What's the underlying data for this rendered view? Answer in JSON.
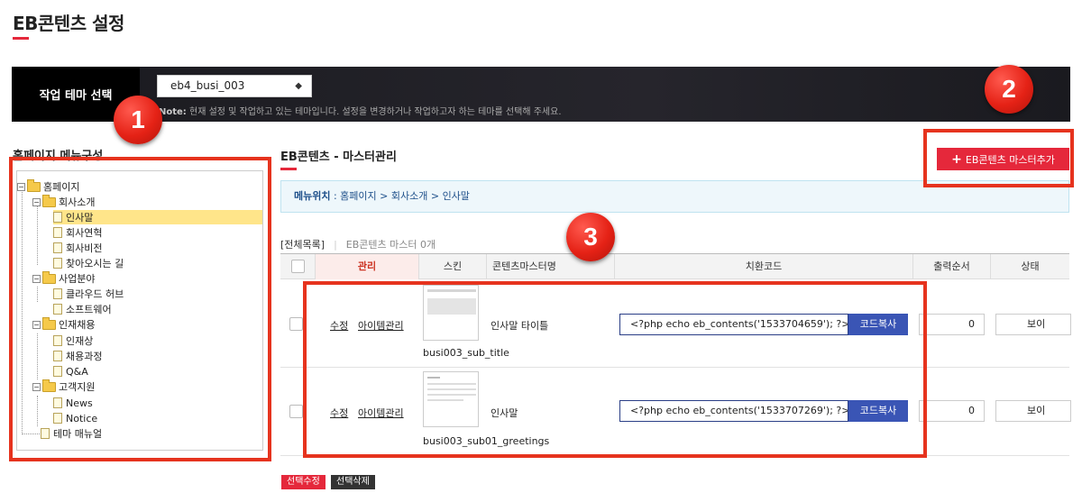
{
  "page": {
    "title": "EB콘텐츠 설정"
  },
  "theme": {
    "label": "작업 테마 선택",
    "selected": "eb4_busi_003",
    "select_arrows": "◆",
    "note_prefix": "Note:",
    "note_text": " 현재 설정 및 작업하고 있는 테마입니다. 설정을 변경하거나 작업하고자 하는 테마를 선택해 주세요."
  },
  "markers": [
    "1",
    "2",
    "3"
  ],
  "menu": {
    "title": "홈페이지 메뉴구성",
    "tree": [
      {
        "label": "홈페이지",
        "type": "folder",
        "toggle": "−"
      },
      {
        "label": "회사소개",
        "type": "folder",
        "toggle": "−"
      },
      {
        "label": "인사말",
        "type": "doc",
        "selected": true
      },
      {
        "label": "회사연혁",
        "type": "doc"
      },
      {
        "label": "회사비전",
        "type": "doc"
      },
      {
        "label": "찾아오시는 길",
        "type": "doc"
      },
      {
        "label": "사업분야",
        "type": "folder",
        "toggle": "−"
      },
      {
        "label": "클라우드 허브",
        "type": "doc"
      },
      {
        "label": "소프트웨어",
        "type": "doc"
      },
      {
        "label": "인재채용",
        "type": "folder",
        "toggle": "−"
      },
      {
        "label": "인재상",
        "type": "doc"
      },
      {
        "label": "채용과정",
        "type": "doc"
      },
      {
        "label": "Q&A",
        "type": "doc"
      },
      {
        "label": "고객지원",
        "type": "folder",
        "toggle": "−"
      },
      {
        "label": "News",
        "type": "doc"
      },
      {
        "label": "Notice",
        "type": "doc"
      },
      {
        "label": "테마 매뉴얼",
        "type": "doc"
      }
    ]
  },
  "content": {
    "title": "EB콘텐츠 - 마스터관리",
    "add_button": "EB콘텐츠 마스터추가",
    "add_plus": "+",
    "location_label": "메뉴위치",
    "location_path": " : 홈페이지 > 회사소개 > 인사말",
    "tab_all": "[전체목록]",
    "tab_sep": "|",
    "tab_count": "EB콘텐츠 마스터 0개",
    "columns": [
      "관리",
      "스킨",
      "콘텐츠마스터명",
      "치환코드",
      "출력순서",
      "상태"
    ],
    "rows": [
      {
        "edit": "수정",
        "items": "아이템관리",
        "skin": "busi003_sub_title",
        "name": "인사말 타이틀",
        "code": "<?php echo eb_contents('1533704659'); ?>",
        "copy": "코드복사",
        "order": "0",
        "status": "보이"
      },
      {
        "edit": "수정",
        "items": "아이템관리",
        "skin": "busi003_sub01_greetings",
        "name": "인사말",
        "code": "<?php echo eb_contents('1533707269'); ?>",
        "copy": "코드복사",
        "order": "0",
        "status": "보이"
      }
    ],
    "bulk_edit": "선택수정",
    "bulk_delete": "선택삭제"
  },
  "colors": {
    "accent": "#e5283b",
    "marker": "#e52216",
    "copy_button": "#3a55b5"
  }
}
